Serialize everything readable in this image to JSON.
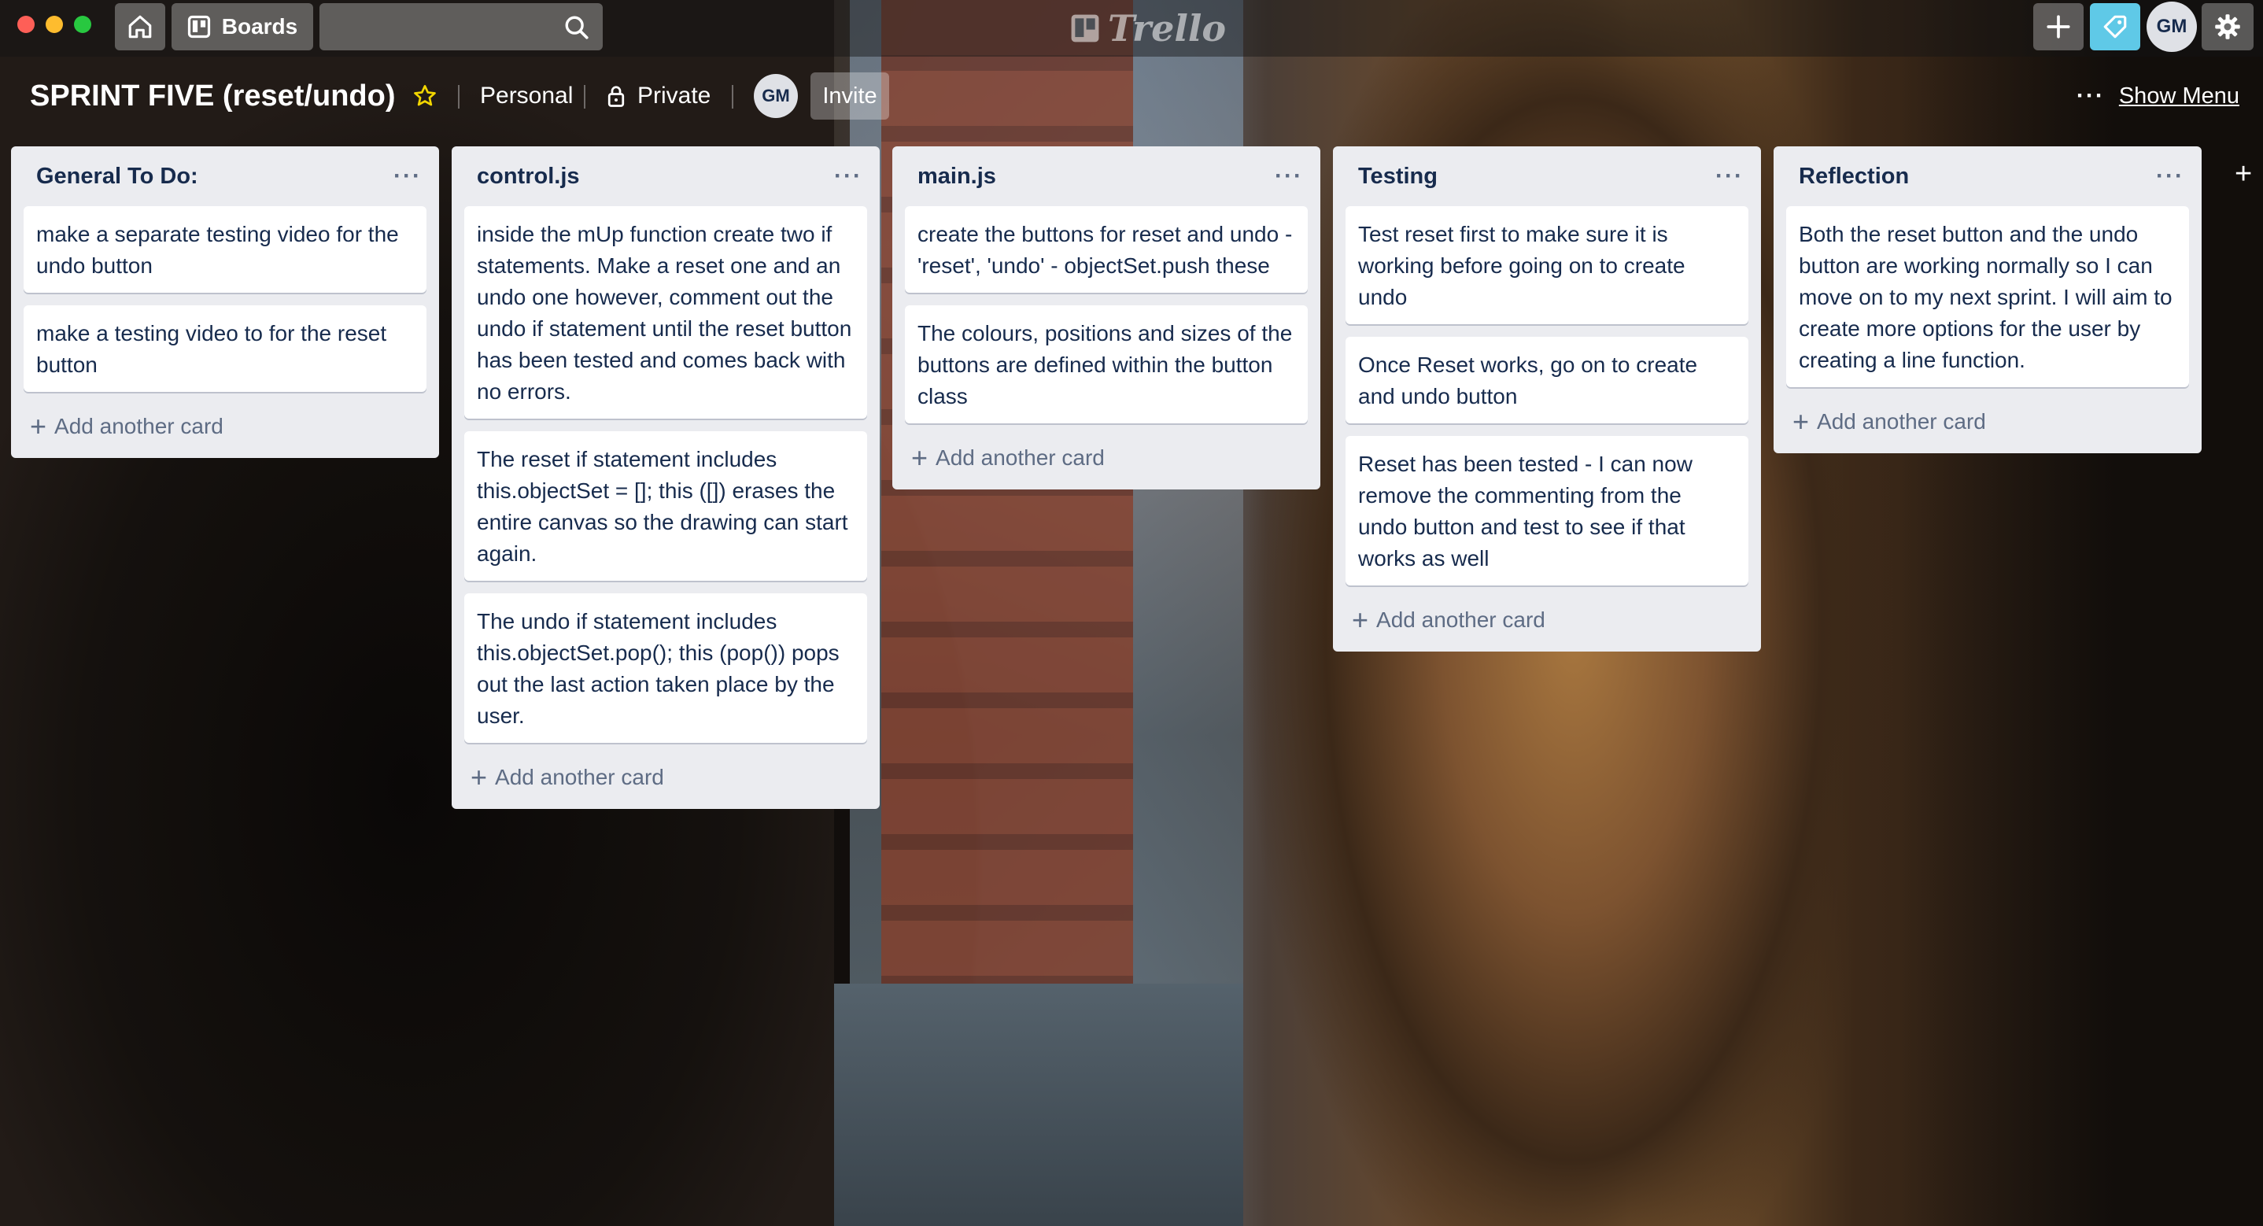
{
  "header": {
    "boards_label": "Boards",
    "logo_text": "Trello",
    "avatar_initials": "GM"
  },
  "board": {
    "title": "SPRINT FIVE (reset/undo)",
    "team_label": "Personal",
    "visibility_label": "Private",
    "member_initials": "GM",
    "invite_label": "Invite",
    "show_menu_label": "Show Menu"
  },
  "add_card_label": "Add another card",
  "lists": [
    {
      "title": "General To Do:",
      "cards": [
        "make a separate testing video for the undo button",
        "make a testing video to for the reset button"
      ]
    },
    {
      "title": "control.js",
      "cards": [
        "inside the mUp function create two if statements. Make a reset one and an undo one however, comment out the undo if statement until the reset button has been tested and comes back with no errors.",
        "The reset if statement includes this.objectSet = []; this ([]) erases the entire canvas so the drawing can start again.",
        "The undo if statement includes this.objectSet.pop(); this (pop()) pops out the last action taken place by the user."
      ]
    },
    {
      "title": "main.js",
      "cards": [
        "create the buttons for reset and undo - 'reset', 'undo' - objectSet.push these",
        "The colours, positions and sizes of the buttons are defined within the button class"
      ]
    },
    {
      "title": "Testing",
      "cards": [
        "Test reset first to make sure it is working before going on to create undo",
        "Once Reset works, go on to create and undo button",
        "Reset has been tested - I can now remove the commenting from the undo button and test to see if that works as well"
      ]
    },
    {
      "title": "Reflection",
      "cards": [
        "Both the reset button and the undo button are working normally so I can move on to my next sprint. I will aim to create more options for the user by creating a line function."
      ]
    }
  ]
}
